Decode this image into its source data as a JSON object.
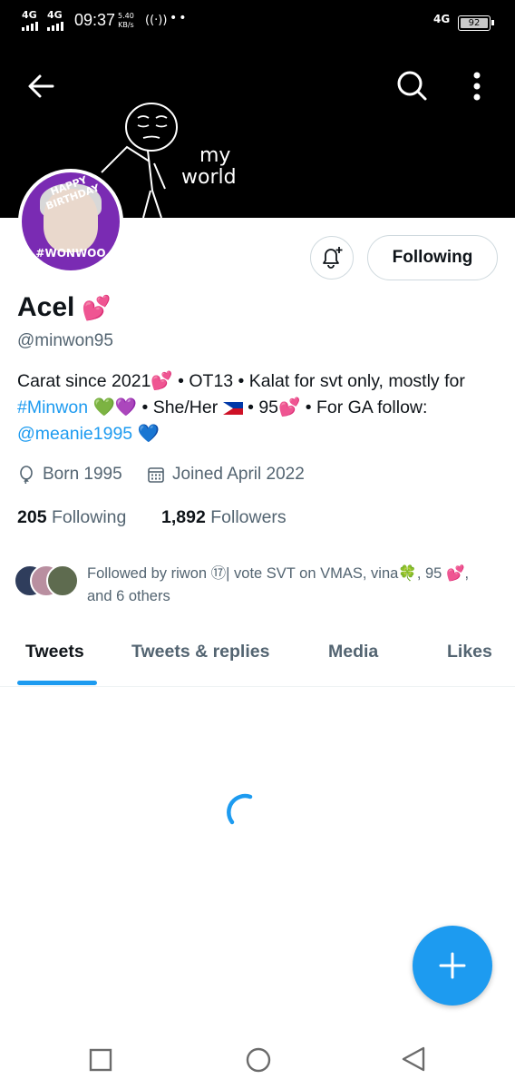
{
  "status_bar": {
    "signal1": "4G",
    "signal2": "4G",
    "time": "09:37",
    "speed_value": "5.40",
    "speed_unit": "KB/s",
    "network_right": "4G",
    "battery": "92"
  },
  "banner": {
    "text_line1": "my",
    "text_line2": "world",
    "back_icon": "arrow-left-icon",
    "search_icon": "search-icon",
    "more_icon": "more-vertical-icon"
  },
  "avatar": {
    "top_text": "HAPPY BIRTHDAY",
    "bottom_text": "#WONWOO"
  },
  "actions": {
    "notify_icon": "bell-plus-icon",
    "follow_label": "Following"
  },
  "profile": {
    "name": "Acel",
    "name_emoji": "💕",
    "handle": "@minwon95",
    "bio": {
      "p1": "Carat since 2021",
      "p2": " • OT13 • Kalat for svt only, mostly for ",
      "hashtag": "#Minwon",
      "p3": " • She/Her ",
      "p4": " • 95",
      "p5": " • For GA follow: ",
      "mention": "@meanie1995",
      "heart": "💕",
      "green_heart": "💚",
      "purple_heart": "💜",
      "blue_heart": "💙"
    },
    "born": "Born 1995",
    "joined": "Joined April 2022",
    "following_count": "205",
    "following_label": "Following",
    "followers_count": "1,892",
    "followers_label": "Followers",
    "followed_by": "Followed by riwon ⑰| vote SVT on VMAS, vina🍀, 95 💕, and 6 others"
  },
  "tabs": [
    "Tweets",
    "Tweets & replies",
    "Media",
    "Likes"
  ],
  "active_tab": "Tweets",
  "fab_icon": "plus-icon",
  "colors": {
    "accent": "#1d9bf0",
    "text_secondary": "#536471",
    "heart": "#e0245e"
  },
  "nav": {
    "recents_icon": "square-icon",
    "home_icon": "circle-icon",
    "back_icon": "triangle-back-icon"
  }
}
